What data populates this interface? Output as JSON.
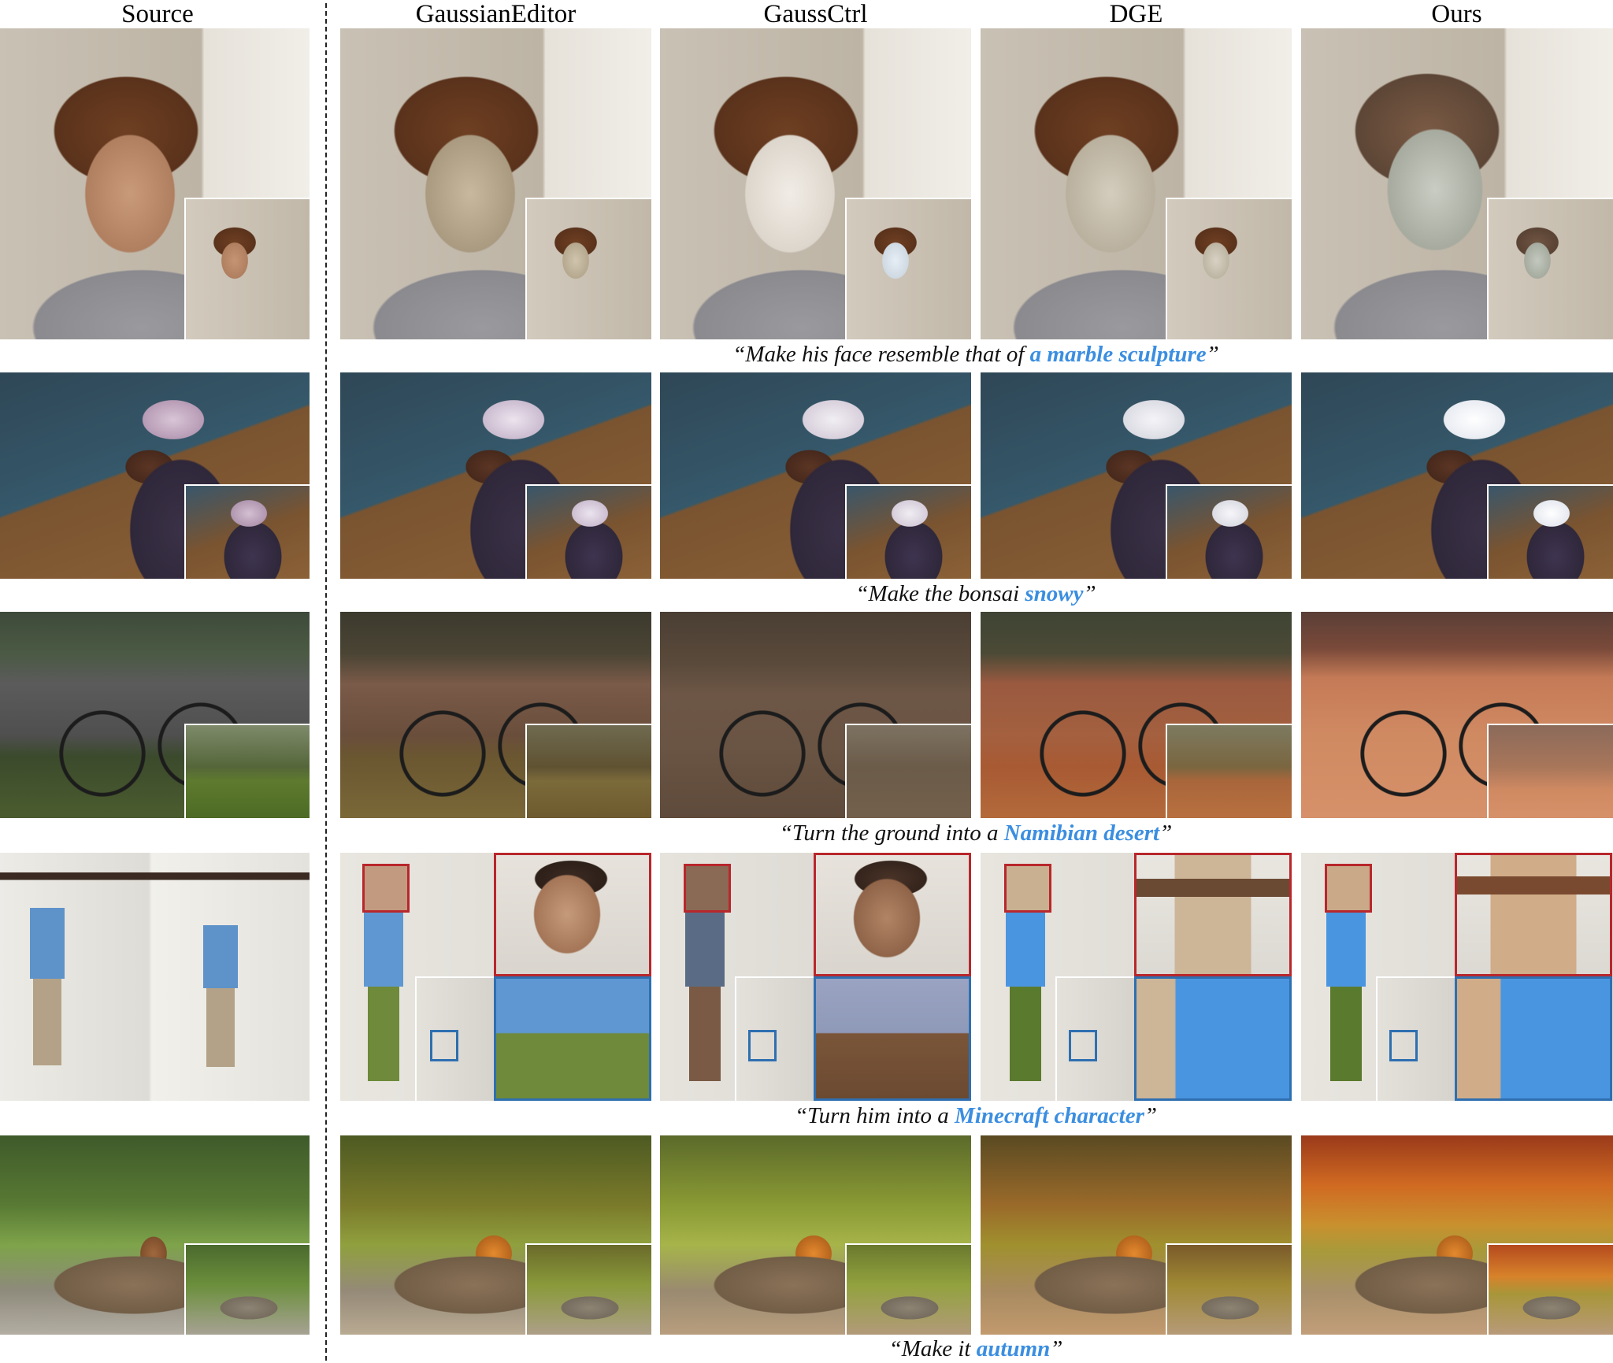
{
  "headers": [
    "Source",
    "GaussianEditor",
    "GaussCtrl",
    "DGE",
    "Ours"
  ],
  "rows": [
    {
      "caption_pre": "“Make his face resemble that of ",
      "caption_highlight": "a marble sculpture",
      "caption_post": "”"
    },
    {
      "caption_pre": "“Make the bonsai ",
      "caption_highlight": "snowy",
      "caption_post": "”"
    },
    {
      "caption_pre": "“Turn the ground into a ",
      "caption_highlight": "Namibian desert",
      "caption_post": "”"
    },
    {
      "caption_pre": "“Turn him into a ",
      "caption_highlight": "Minecraft character",
      "caption_post": "”"
    },
    {
      "caption_pre": "“Make it ",
      "caption_highlight": "autumn",
      "caption_post": "”"
    }
  ],
  "colors": {
    "highlight": "#3b8ee0",
    "zoom_red": "#b8272c",
    "zoom_blue": "#2e6fb0"
  }
}
